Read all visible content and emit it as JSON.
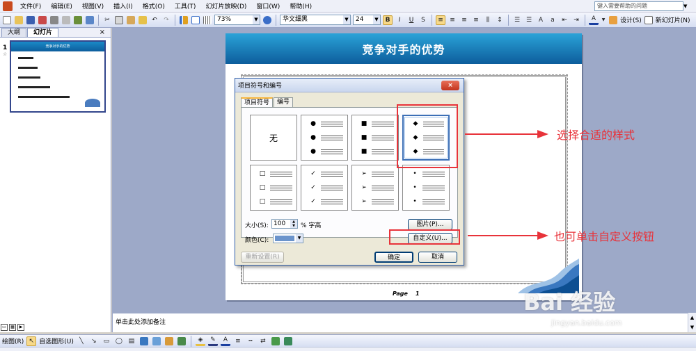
{
  "menubar": {
    "items": [
      "文件(F)",
      "编辑(E)",
      "视图(V)",
      "插入(I)",
      "格式(O)",
      "工具(T)",
      "幻灯片放映(D)",
      "窗口(W)",
      "帮助(H)"
    ],
    "help_placeholder": "键入需要帮助的问题"
  },
  "toolbar": {
    "zoom": "73%",
    "font": "华文细黑",
    "size": "24",
    "bold": "B",
    "italic": "I",
    "underline": "U",
    "shadow": "S",
    "design_label": "设计(S)",
    "new_slide_label": "新幻灯片(N)"
  },
  "left_panel": {
    "tab_outline": "大纲",
    "tab_slides": "幻灯片",
    "close": "×",
    "slide_number": "1",
    "thumb_title": "竞争对手的优势"
  },
  "slide": {
    "title": "竞争对手的优势",
    "page_label": "Page",
    "page_number": "1"
  },
  "dialog": {
    "title": "项目符号和编号",
    "close": "×",
    "tab_bullets": "项目符号",
    "tab_numbering": "编号",
    "none_label": "无",
    "size_label": "大小(S):",
    "size_value": "100",
    "size_unit": "% 字高",
    "color_label": "颜色(C):",
    "picture_button": "图片(P)...",
    "customize_button": "自定义(U)...",
    "reset_button": "重新设置(R)",
    "ok_button": "确定",
    "cancel_button": "取消",
    "styles": [
      {
        "symbol": "●"
      },
      {
        "symbol": "■"
      },
      {
        "symbol": "◆",
        "selected": true
      },
      {
        "symbol": "□"
      },
      {
        "symbol": "✓"
      },
      {
        "symbol": "➢"
      },
      {
        "symbol": "•"
      }
    ]
  },
  "annotations": {
    "choose_style": "选择合适的样式",
    "customize_hint": "也可单击自定义按钮",
    "color": "#e8333a"
  },
  "notes": {
    "placeholder": "单击此处添加备注"
  },
  "drawbar": {
    "draw_label": "绘图(R)",
    "autoshape_label": "自选图形(U)"
  },
  "watermark": {
    "main": "Bai 经验",
    "sub": "jingyan.baidu.com"
  },
  "colors": {
    "accent": "#0d5d9c",
    "bullet_color": "#6b94cc"
  }
}
